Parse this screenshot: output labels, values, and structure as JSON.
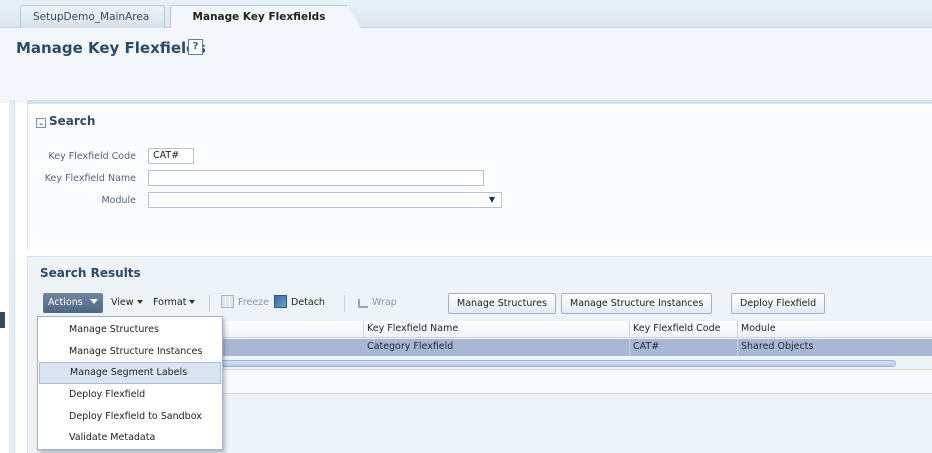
{
  "tabs": [
    {
      "label": "SetupDemo_MainArea",
      "active": false
    },
    {
      "label": "Manage Key Flexfields",
      "active": true
    }
  ],
  "page": {
    "title": "Manage Key Flexfields",
    "help_glyph": "?"
  },
  "search": {
    "header": "Search",
    "fields": {
      "code_label": "Key Flexfield Code",
      "code_value": "CAT#",
      "name_label": "Key Flexfield Name",
      "name_value": "",
      "module_label": "Module",
      "module_value": ""
    }
  },
  "results": {
    "header": "Search Results",
    "toolbar": {
      "actions": "Actions",
      "view": "View",
      "format": "Format",
      "freeze": "Freeze",
      "detach": "Detach",
      "wrap": "Wrap",
      "manage_structures": "Manage Structures",
      "manage_structure_instances": "Manage Structure Instances",
      "deploy_flexfield": "Deploy Flexfield"
    },
    "columns": [
      "Key Flexfield Name",
      "Key Flexfield Code",
      "Module"
    ],
    "rows": [
      {
        "name": "Category Flexfield",
        "code": "CAT#",
        "module": "Shared Objects",
        "selected": true
      }
    ]
  },
  "actions_menu": {
    "items": [
      {
        "label": "Manage Structures"
      },
      {
        "label": "Manage Structure Instances"
      },
      {
        "label": "Manage Segment Labels",
        "hover": true
      },
      {
        "label": "Deploy Flexfield"
      },
      {
        "label": "Deploy Flexfield to Sandbox"
      },
      {
        "label": "Validate Metadata"
      }
    ]
  },
  "colors": {
    "title": "#2d4a6b",
    "actions_button": "#4d6783",
    "selected_row": "#a8b7d3",
    "menu_hover": "#dbe5f1"
  },
  "icons": [
    "help-icon",
    "disclose-icon",
    "chevron-down-icon",
    "freeze-icon",
    "detach-icon",
    "wrap-icon",
    "select-arrow-icon"
  ]
}
